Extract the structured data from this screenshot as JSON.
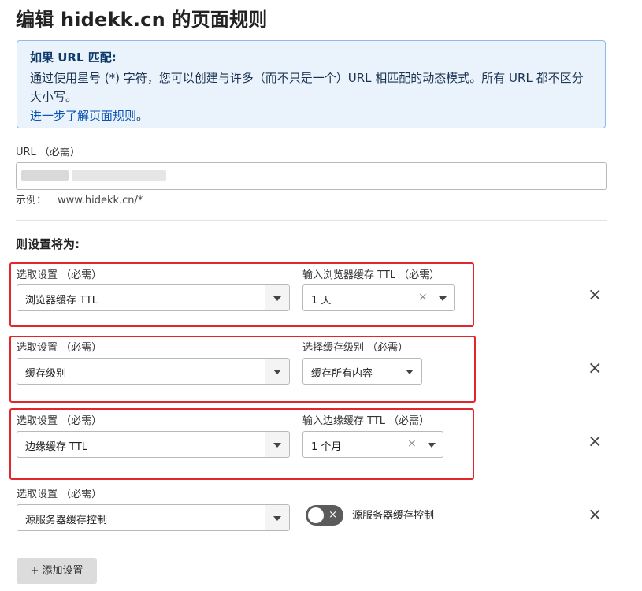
{
  "page": {
    "title": "编辑 hidekk.cn 的页面规则"
  },
  "info": {
    "title": "如果 URL 匹配:",
    "body": "通过使用星号 (*) 字符，您可以创建与许多（而不只是一个）URL 相匹配的动态模式。所有 URL 都不区分大小写。",
    "link": "进一步了解页面规则",
    "link_suffix": "。"
  },
  "url": {
    "label": "URL （必需）",
    "example_label": "示例：",
    "example_value": "www.hidekk.cn/*"
  },
  "settings": {
    "section_title": "则设置将为:",
    "select_label": "选取设置 （必需）",
    "rows": [
      {
        "setting": "浏览器缓存 TTL",
        "value_label": "输入浏览器缓存 TTL （必需）",
        "value": "1 天",
        "clear": "×"
      },
      {
        "setting": "缓存级别",
        "value_label": "选择缓存级别 （必需）",
        "value": "缓存所有内容"
      },
      {
        "setting": "边缘缓存 TTL",
        "value_label": "输入边缘缓存 TTL （必需）",
        "value": "1 个月",
        "clear": "×"
      },
      {
        "setting": "源服务器缓存控制",
        "toggle_state": "×",
        "toggle_label": "源服务器缓存控制"
      }
    ],
    "remove": "×",
    "add_button": "+ 添加设置"
  },
  "colors": {
    "highlight_frame": "#e2262b",
    "info_background": "#eaf3fc",
    "info_border": "#8bbbe6",
    "link": "#0a55b3",
    "toggle_off": "#5b5b5b"
  },
  "icons": {
    "dropdown": "chevron-down-icon",
    "remove": "close-icon",
    "clear": "clear-icon"
  }
}
